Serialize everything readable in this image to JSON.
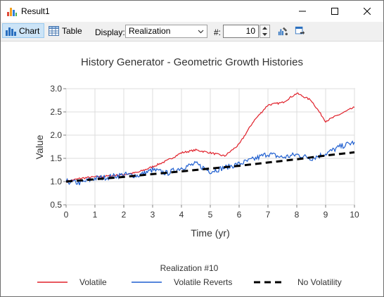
{
  "window": {
    "title": "Result1"
  },
  "toolbar": {
    "chart_label": "Chart",
    "table_label": "Table",
    "display_label": "Display:",
    "display_value": "Realization",
    "hash_label": "#:",
    "realization_number": "10"
  },
  "chart_data": {
    "type": "line",
    "title": "History Generator - Geometric Growth Histories",
    "xlabel": "Time (yr)",
    "ylabel": "Value",
    "xlim": [
      0,
      10
    ],
    "ylim": [
      0.5,
      3.0
    ],
    "xticks": [
      "0",
      "1",
      "2",
      "3",
      "4",
      "5",
      "6",
      "7",
      "8",
      "9",
      "10"
    ],
    "yticks": [
      "0.5",
      "1.0",
      "1.5",
      "2.0",
      "2.5",
      "3.0"
    ],
    "grid": true,
    "legend_title": "Realization #10",
    "legend_position": "bottom",
    "series": [
      {
        "name": "Volatile",
        "color": "#e0202a",
        "style": "solid",
        "x": [
          0,
          0.5,
          1,
          1.5,
          2,
          2.5,
          3,
          3.5,
          4,
          4.5,
          5,
          5.5,
          6,
          6.5,
          7,
          7.5,
          8,
          8.5,
          9,
          9.5,
          10
        ],
        "y": [
          1.0,
          1.07,
          1.1,
          1.12,
          1.15,
          1.2,
          1.32,
          1.45,
          1.62,
          1.68,
          1.62,
          1.55,
          1.8,
          2.3,
          2.65,
          2.7,
          2.9,
          2.75,
          2.3,
          2.45,
          2.6
        ]
      },
      {
        "name": "Volatile Reverts",
        "color": "#1f5fd0",
        "style": "solid",
        "x": [
          0,
          0.5,
          1,
          1.5,
          2,
          2.5,
          3,
          3.5,
          4,
          4.5,
          5,
          5.5,
          6,
          6.5,
          7,
          7.5,
          8,
          8.5,
          9,
          9.5,
          10
        ],
        "y": [
          1.0,
          0.97,
          1.07,
          1.1,
          1.15,
          1.13,
          1.25,
          1.18,
          1.3,
          1.38,
          1.22,
          1.3,
          1.38,
          1.48,
          1.6,
          1.52,
          1.58,
          1.5,
          1.6,
          1.75,
          1.85
        ]
      },
      {
        "name": "No Volatility",
        "color": "#000000",
        "style": "dashed",
        "x": [
          0,
          1,
          2,
          3,
          4,
          5,
          6,
          7,
          8,
          9,
          10
        ],
        "y": [
          1.0,
          1.05,
          1.1,
          1.16,
          1.22,
          1.28,
          1.34,
          1.41,
          1.48,
          1.56,
          1.63
        ]
      }
    ]
  }
}
